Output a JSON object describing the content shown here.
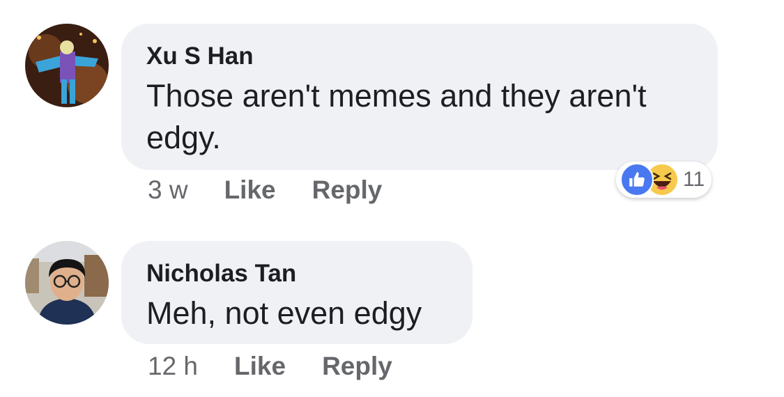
{
  "comments": [
    {
      "author": "Xu S Han",
      "text": "Those aren't memes and they aren't edgy.",
      "time": "3 w",
      "like_label": "Like",
      "reply_label": "Reply",
      "reactions": {
        "icons": [
          "like-icon",
          "haha-icon"
        ],
        "count": "11"
      }
    },
    {
      "author": "Nicholas Tan",
      "text": "Meh, not even edgy",
      "time": "12 h",
      "like_label": "Like",
      "reply_label": "Reply"
    }
  ],
  "colors": {
    "bubble": "#f0f1f4",
    "meta_text": "#65676b",
    "like_blue": "#4a78f0",
    "haha_yellow": "#f7c94c"
  }
}
